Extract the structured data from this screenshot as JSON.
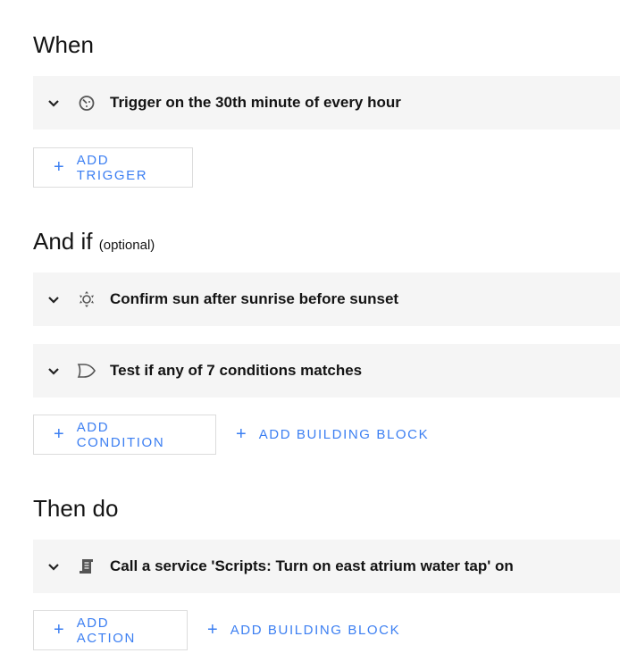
{
  "sections": {
    "when": {
      "title": "When",
      "cards": [
        {
          "icon": "timer-clock-icon",
          "label": "Trigger on the 30th minute of every hour"
        }
      ],
      "add_label": "ADD TRIGGER"
    },
    "and_if": {
      "title": "And if",
      "optional": "(optional)",
      "cards": [
        {
          "icon": "sun-icon",
          "label": "Confirm sun after sunrise before sunset"
        },
        {
          "icon": "or-gate-icon",
          "label": "Test if any of 7 conditions matches"
        }
      ],
      "add_label": "ADD CONDITION",
      "add_block_label": "ADD BUILDING BLOCK"
    },
    "then_do": {
      "title": "Then do",
      "cards": [
        {
          "icon": "script-scroll-icon",
          "label": "Call a service 'Scripts: Turn on east atrium water tap' on"
        }
      ],
      "add_label": "ADD ACTION",
      "add_block_label": "ADD BUILDING BLOCK"
    }
  },
  "plus": "+"
}
